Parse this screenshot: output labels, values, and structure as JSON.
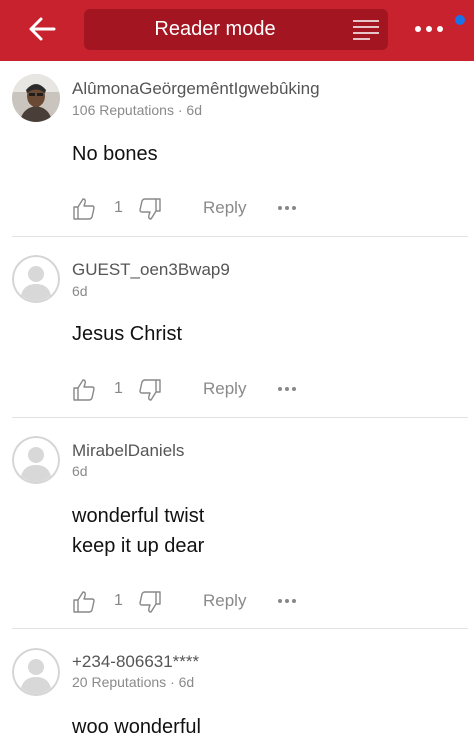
{
  "header": {
    "title": "Reader mode",
    "back_icon": "arrow-left-icon",
    "menu_icon": "text-lines-icon",
    "more_icon": "more-horizontal-icon",
    "notification_dot_color": "#1a73e8",
    "bar_color": "#c8222f",
    "pill_color": "#a31520"
  },
  "comments": [
    {
      "username": "AlûmonaGeörgemêntIgwebûking",
      "meta": "106 Reputations · 6d",
      "body_lines": [
        "No bones"
      ],
      "likes": "1",
      "reply_label": "Reply",
      "avatar": "photo"
    },
    {
      "username": "GUEST_oen3Bwap9",
      "meta": "6d",
      "body_lines": [
        "Jesus Christ"
      ],
      "likes": "1",
      "reply_label": "Reply",
      "avatar": "default"
    },
    {
      "username": "MirabelDaniels",
      "meta": "6d",
      "body_lines": [
        "wonderful twist",
        "keep it up dear"
      ],
      "likes": "1",
      "reply_label": "Reply",
      "avatar": "default"
    },
    {
      "username": "+234-806631****",
      "meta": "20 Reputations · 6d",
      "body_lines": [
        "woo wonderful"
      ],
      "avatar": "default"
    }
  ]
}
